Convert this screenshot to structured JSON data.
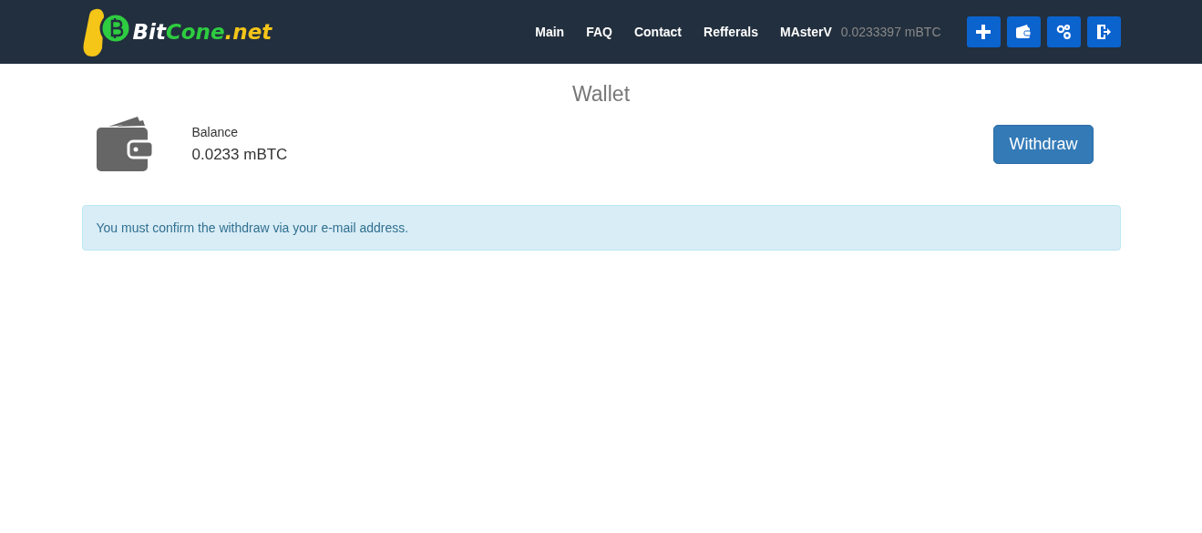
{
  "header": {
    "logo": [
      {
        "text": "Bit",
        "color": "#ffffff"
      },
      {
        "text": "Cone",
        "color": "#2ecc40"
      },
      {
        "text": ".net",
        "color": "#f5c518"
      }
    ],
    "nav": [
      "Main",
      "FAQ",
      "Contact",
      "Refferals"
    ],
    "user": "MAsterV",
    "user_balance": "0.0233397 mBTC",
    "icon_buttons": [
      {
        "kind": "plus"
      },
      {
        "kind": "wallet"
      },
      {
        "kind": "gears"
      },
      {
        "kind": "logout"
      }
    ]
  },
  "page_title": "Wallet",
  "balance": {
    "label": "Balance",
    "value": "0.0233 mBTC"
  },
  "withdraw_button": "Withdraw",
  "alert": "You must confirm the withdraw via your e-mail address."
}
